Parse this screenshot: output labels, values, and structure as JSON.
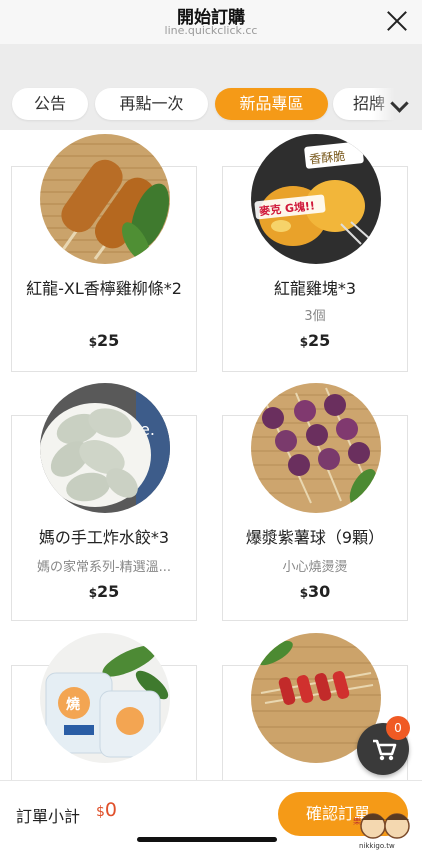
{
  "header": {
    "title": "開始訂購",
    "url": "line.quickclick.cc"
  },
  "tabs": [
    {
      "label": "公告",
      "active": false
    },
    {
      "label": "再點一次",
      "active": false
    },
    {
      "label": "新品專區",
      "active": true
    },
    {
      "label": "招牌",
      "active": false
    }
  ],
  "products": [
    {
      "name": "紅龍-XL香檸雞柳條*2",
      "subtitle": "",
      "currency": "$",
      "price": "25"
    },
    {
      "name": "紅龍雞塊*3",
      "subtitle": "3個",
      "currency": "$",
      "price": "25",
      "image_text": [
        "香酥脆",
        "麥克 G塊!!"
      ]
    },
    {
      "name": "媽の手工炸水餃*3",
      "subtitle": "媽の家常系列-精選溫...",
      "currency": "$",
      "price": "25",
      "image_text": [
        "e."
      ]
    },
    {
      "name": "爆漿紫薯球（9顆）",
      "subtitle": "小心燒燙燙",
      "currency": "$",
      "price": "30"
    },
    {
      "name": "",
      "subtitle": "",
      "currency": "",
      "price": "",
      "image_text": [
        "燒"
      ]
    },
    {
      "name": "",
      "subtitle": "",
      "currency": "",
      "price": ""
    }
  ],
  "cart": {
    "count": "0",
    "icon": "shopping-cart-icon"
  },
  "footer": {
    "subtotal_label": "訂單小計",
    "currency": "$",
    "subtotal_value": "0",
    "confirm_label": "確認訂單"
  },
  "logo_text": [
    "樂",
    "nikkigo.tw"
  ],
  "colors": {
    "accent": "#f59a17",
    "price_red": "#e0502a",
    "fab": "#3a3a3a"
  }
}
